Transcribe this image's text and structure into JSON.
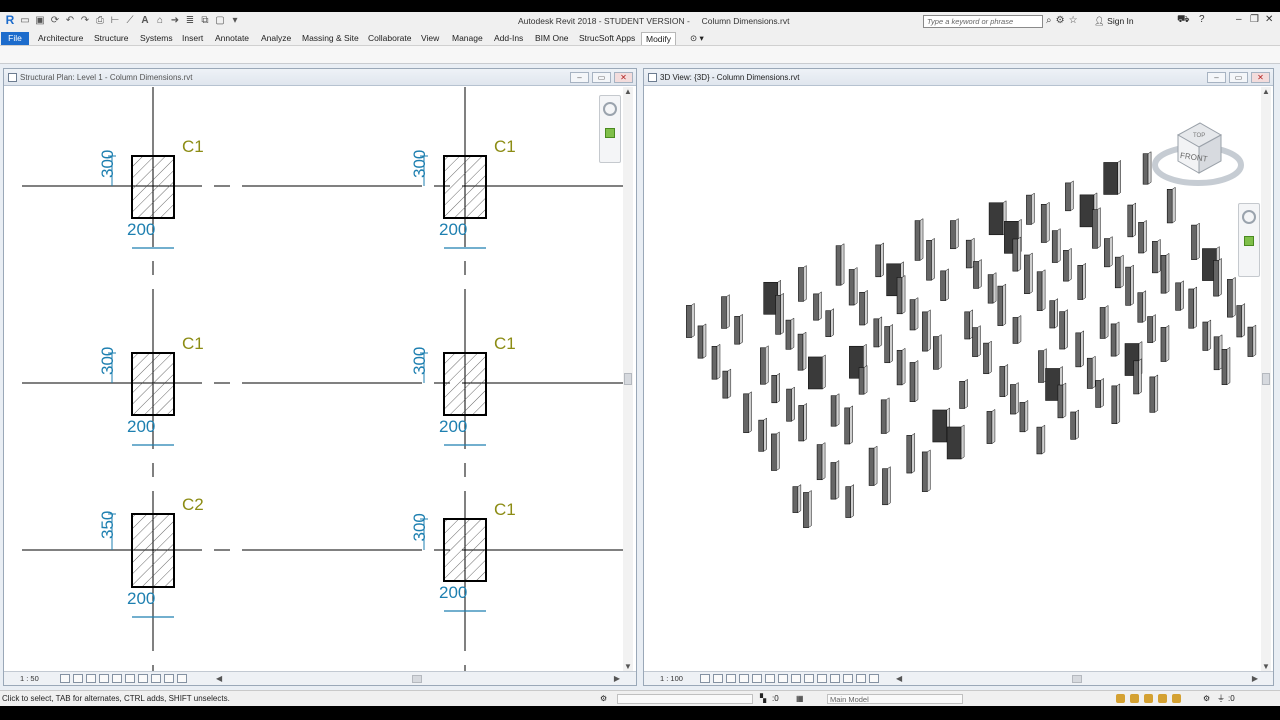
{
  "app": {
    "title": "Autodesk Revit 2018 - STUDENT VERSION -     Column Dimensions.rvt",
    "search_placeholder": "Type a keyword or phrase",
    "sign_in": "Sign In"
  },
  "ribbon": {
    "tabs": [
      "File",
      "Architecture",
      "Structure",
      "Systems",
      "Insert",
      "Annotate",
      "Analyze",
      "Massing & Site",
      "Collaborate",
      "View",
      "Manage",
      "Add-Ins",
      "BIM One",
      "StrucSoft Apps",
      "Modify"
    ],
    "active_tab": "Modify"
  },
  "left_view": {
    "title": "Structural Plan: Level 1 - Column Dimensions.rvt",
    "scale": "1 : 50",
    "columns": [
      {
        "tag": "C1",
        "depth": "300",
        "width": "200"
      },
      {
        "tag": "C1",
        "depth": "300",
        "width": "200"
      },
      {
        "tag": "C1",
        "depth": "300",
        "width": "200"
      },
      {
        "tag": "C1",
        "depth": "300",
        "width": "200"
      },
      {
        "tag": "C2",
        "depth": "350",
        "width": "200"
      },
      {
        "tag": "C1",
        "depth": "300",
        "width": "200"
      }
    ]
  },
  "right_view": {
    "title": "3D View: {3D} - Column Dimensions.rvt",
    "scale": "1 : 100",
    "viewcube": {
      "top": "TOP",
      "front": "FRONT"
    }
  },
  "statusbar": {
    "hint": "Click to select, TAB for alternates, CTRL adds, SHIFT unselects.",
    "selection_count": ":0",
    "model": "Main Model",
    "filter_count": ":0"
  },
  "colors": {
    "file_tab": "#1d6ccc",
    "dimension": "#1d7fb0",
    "tag": "#8c8c14",
    "column_outline": "#000000"
  },
  "icons": [
    "revit-logo-icon",
    "open-icon",
    "save-icon",
    "undo-icon",
    "redo-icon",
    "print-icon",
    "measure-icon",
    "text-icon",
    "search-icon",
    "star-icon",
    "user-icon",
    "cart-icon",
    "help-icon",
    "steering-wheel-icon",
    "zoom-icon",
    "view-cube-icon"
  ]
}
